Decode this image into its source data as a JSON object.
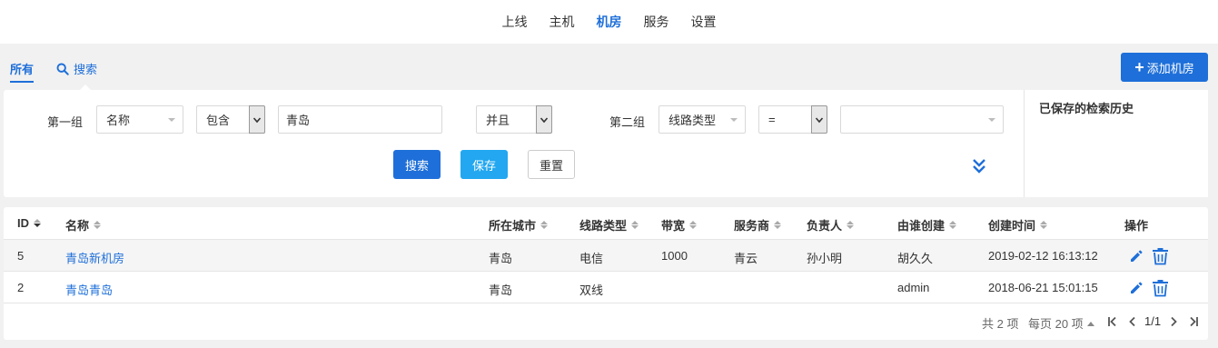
{
  "nav": {
    "items": [
      {
        "label": "上线"
      },
      {
        "label": "主机"
      },
      {
        "label": "机房"
      },
      {
        "label": "服务"
      },
      {
        "label": "设置"
      }
    ],
    "active_index": 2
  },
  "tabs": {
    "all": "所有",
    "search": "搜索"
  },
  "add_button": "添加机房",
  "filter": {
    "group1": {
      "label": "第一组",
      "field": "名称",
      "operator": "包含",
      "value": "青岛"
    },
    "conjunction": "并且",
    "group2": {
      "label": "第二组",
      "field": "线路类型",
      "operator": "=",
      "value": ""
    },
    "buttons": {
      "search": "搜索",
      "save": "保存",
      "reset": "重置"
    }
  },
  "history": {
    "title": "已保存的检索历史"
  },
  "table": {
    "columns": [
      "ID",
      "名称",
      "所在城市",
      "线路类型",
      "带宽",
      "服务商",
      "负责人",
      "由谁创建",
      "创建时间",
      "操作"
    ],
    "rows": [
      {
        "id": "5",
        "name": "青岛新机房",
        "city": "青岛",
        "line": "电信",
        "bandwidth": "1000",
        "provider": "青云",
        "owner": "孙小明",
        "creator": "胡久久",
        "created": "2019-02-12 16:13:12"
      },
      {
        "id": "2",
        "name": "青岛青岛",
        "city": "青岛",
        "line": "双线",
        "bandwidth": "",
        "provider": "",
        "owner": "",
        "creator": "admin",
        "created": "2018-06-21 15:01:15"
      }
    ]
  },
  "pagination": {
    "total": "共 2 项",
    "per_page": "每页 20 项",
    "page": "1/1"
  },
  "colors": {
    "accent": "#1e6fd9",
    "info": "#22a7f0"
  }
}
